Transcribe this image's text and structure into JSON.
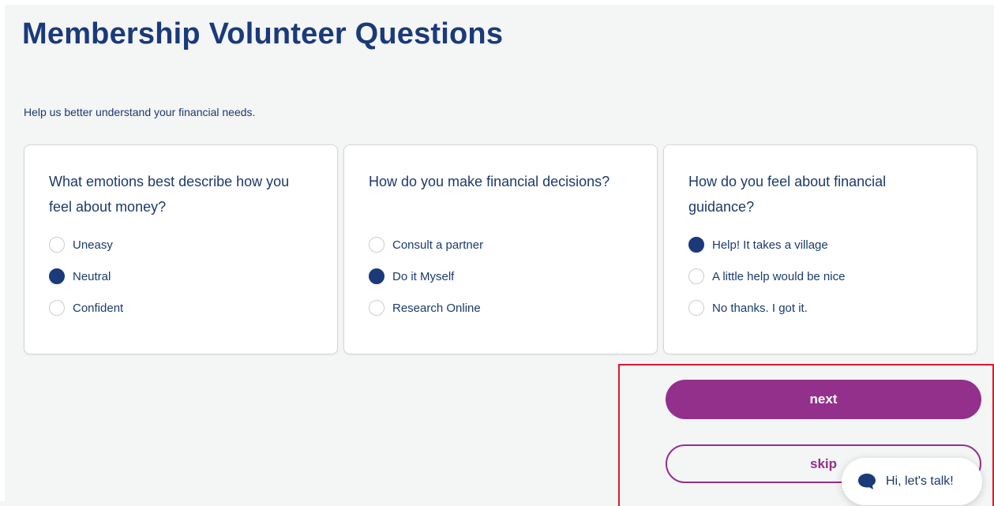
{
  "header": {
    "title": "Membership Volunteer Questions",
    "subtitle": "Help us better understand your financial needs."
  },
  "questions": [
    {
      "text": "What emotions best describe how you feel about money?",
      "options": [
        {
          "label": "Uneasy",
          "selected": false
        },
        {
          "label": "Neutral",
          "selected": true
        },
        {
          "label": "Confident",
          "selected": false
        }
      ]
    },
    {
      "text": "How do you make financial decisions?",
      "options": [
        {
          "label": "Consult a partner",
          "selected": false
        },
        {
          "label": "Do it Myself",
          "selected": true
        },
        {
          "label": "Research Online",
          "selected": false
        }
      ]
    },
    {
      "text": "How do you feel about financial guidance?",
      "options": [
        {
          "label": "Help! It takes a village",
          "selected": true
        },
        {
          "label": "A little help would be nice",
          "selected": false
        },
        {
          "label": "No thanks. I got it.",
          "selected": false
        }
      ]
    }
  ],
  "actions": {
    "next_label": "next",
    "skip_label": "skip"
  },
  "chat": {
    "label": "Hi, let's talk!",
    "icon": "chat-bubble-icon"
  },
  "colors": {
    "primary_navy": "#1a3a7a",
    "accent_purple": "#93308b",
    "highlight_red": "#e0192f",
    "background": "#f4f5f5"
  }
}
